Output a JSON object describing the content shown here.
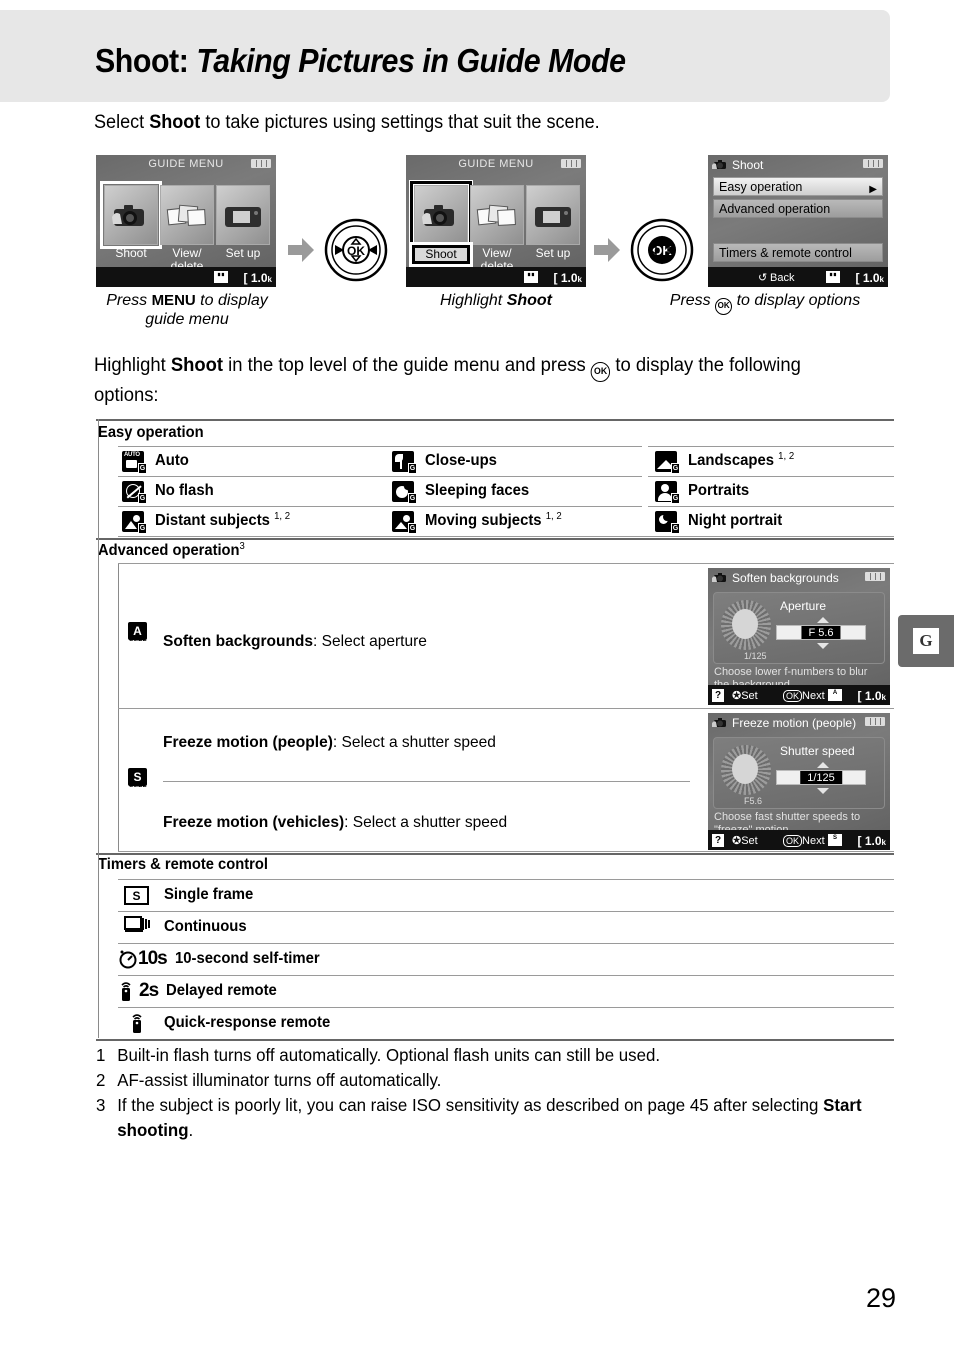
{
  "page": {
    "title_main": "Shoot:",
    "title_italic": "Taking Pictures in Guide Mode",
    "page_number": "29",
    "side_tab_letter": "G"
  },
  "intro": {
    "text_1": "Select ",
    "bold_1": "Shoot",
    "text_2": " to take pictures using settings that suit the scene."
  },
  "steps": [
    {
      "screen": {
        "title": "GUIDE MENU",
        "tiles": [
          {
            "label": "Shoot",
            "selected": true
          },
          {
            "label": "View/ delete",
            "selected": false
          },
          {
            "label": "Set up",
            "selected": false
          }
        ],
        "shots_remaining": "1.0",
        "shots_unit": "k"
      },
      "caption_pre": "Press ",
      "caption_key": "MENU",
      "caption_post": " to display guide menu"
    },
    {
      "screen": {
        "title": "GUIDE MENU",
        "tiles": [
          {
            "label": "Shoot",
            "selected": true
          },
          {
            "label": "View/ delete",
            "selected": false
          },
          {
            "label": "Set up",
            "selected": false
          }
        ],
        "shots_remaining": "1.0",
        "shots_unit": "k"
      },
      "caption_pre": "Highlight ",
      "caption_bold": "Shoot",
      "caption_post": ""
    },
    {
      "screen": {
        "title": "Shoot",
        "rows": [
          {
            "label": "Easy operation",
            "selected": true,
            "arrow": true
          },
          {
            "label": "Advanced operation",
            "selected": false,
            "arrow": false
          },
          {
            "label": "Timers & remote control",
            "selected": false,
            "arrow": false
          }
        ],
        "back_label": "Back",
        "shots_remaining": "1.0",
        "shots_unit": "k"
      },
      "caption_pre": "Press ",
      "caption_key_ok": "OK",
      "caption_post": " to display options"
    }
  ],
  "body_paragraph": {
    "part1": "Highlight ",
    "bold1": "Shoot",
    "part2": " in the top level of the guide menu and press ",
    "ok": "OK",
    "part3": " to display the following options:"
  },
  "tables": {
    "easy_operation": {
      "heading": "Easy operation",
      "columns": [
        [
          {
            "icon": "auto-scene-icon",
            "glyph": "AUTO",
            "label": "Auto",
            "sup": ""
          },
          {
            "icon": "no-flash-scene-icon",
            "glyph": "ⓧ",
            "label": "No flash",
            "sup": ""
          },
          {
            "icon": "distant-subjects-scene-icon",
            "glyph": "⛰",
            "label": "Distant subjects",
            "sup": "1, 2"
          }
        ],
        [
          {
            "icon": "close-ups-scene-icon",
            "glyph": "❀",
            "label": "Close-ups",
            "sup": ""
          },
          {
            "icon": "sleeping-faces-scene-icon",
            "glyph": "☽",
            "label": "Sleeping faces",
            "sup": ""
          },
          {
            "icon": "moving-subjects-scene-icon",
            "glyph": "⛹",
            "label": "Moving subjects",
            "sup": "1, 2"
          }
        ],
        [
          {
            "icon": "landscapes-scene-icon",
            "glyph": "◢",
            "label": "Landscapes",
            "sup": "1, 2"
          },
          {
            "icon": "portraits-scene-icon",
            "glyph": "♟",
            "label": "Portraits",
            "sup": ""
          },
          {
            "icon": "night-portrait-scene-icon",
            "glyph": "☾",
            "label": "Night portrait",
            "sup": ""
          }
        ]
      ]
    },
    "advanced_operation": {
      "heading": "Advanced operation",
      "heading_sup": "3",
      "rows": [
        {
          "icon_letter": "A",
          "icon_sub": "GUIDE",
          "items": [
            {
              "bold": "Soften backgrounds",
              "rest": ": Select aperture"
            }
          ],
          "screen": {
            "title": "Soften backgrounds",
            "setting_label": "Aperture",
            "value": "F 5.6",
            "dial_sub": "1/125",
            "help_line1": "Choose lower f-numbers to blur",
            "help_line2": "the background.",
            "help_icon": "?",
            "set_label": "Set",
            "next_label": "Next",
            "ok_label": "OK",
            "mode_badge": "A",
            "shots_remaining": "1.0",
            "shots_unit": "k"
          }
        },
        {
          "icon_letter": "S",
          "icon_sub": "GUIDE",
          "items": [
            {
              "bold": "Freeze motion (people)",
              "rest": ": Select a shutter speed"
            },
            {
              "bold": "Freeze motion (vehicles)",
              "rest": ": Select a shutter speed"
            }
          ],
          "screen": {
            "title": "Freeze motion (people)",
            "setting_label": "Shutter speed",
            "value": "1/125",
            "dial_sub": "F5.6",
            "help_line1": "Choose fast shutter speeds to",
            "help_line2": "\"freeze\" motion.",
            "help_icon": "?",
            "set_label": "Set",
            "next_label": "Next",
            "ok_label": "OK",
            "mode_badge": "S",
            "shots_remaining": "1.0",
            "shots_unit": "k"
          }
        }
      ]
    },
    "timers_remote": {
      "heading": "Timers & remote control",
      "rows": [
        {
          "icon": "single-frame-icon",
          "icon_text": "S",
          "label": "Single frame"
        },
        {
          "icon": "continuous-icon",
          "icon_text": "",
          "label": "Continuous"
        },
        {
          "icon": "self-timer-icon",
          "icon_text": "10s",
          "label": "10-second self-timer"
        },
        {
          "icon": "delayed-remote-icon",
          "icon_text": "2s",
          "label": "Delayed remote"
        },
        {
          "icon": "quick-response-remote-icon",
          "icon_text": "",
          "label": "Quick-response remote"
        }
      ]
    }
  },
  "footnotes": [
    {
      "num": "1",
      "text": "Built-in flash turns off automatically.  Optional flash units can still be used."
    },
    {
      "num": "2",
      "text": "AF-assist illuminator turns off automatically."
    },
    {
      "num": "3",
      "text_pre": "If the subject is poorly lit, you can raise ISO sensitivity as described on page 45 after selecting ",
      "bold": "Start shooting",
      "text_post": "."
    }
  ]
}
